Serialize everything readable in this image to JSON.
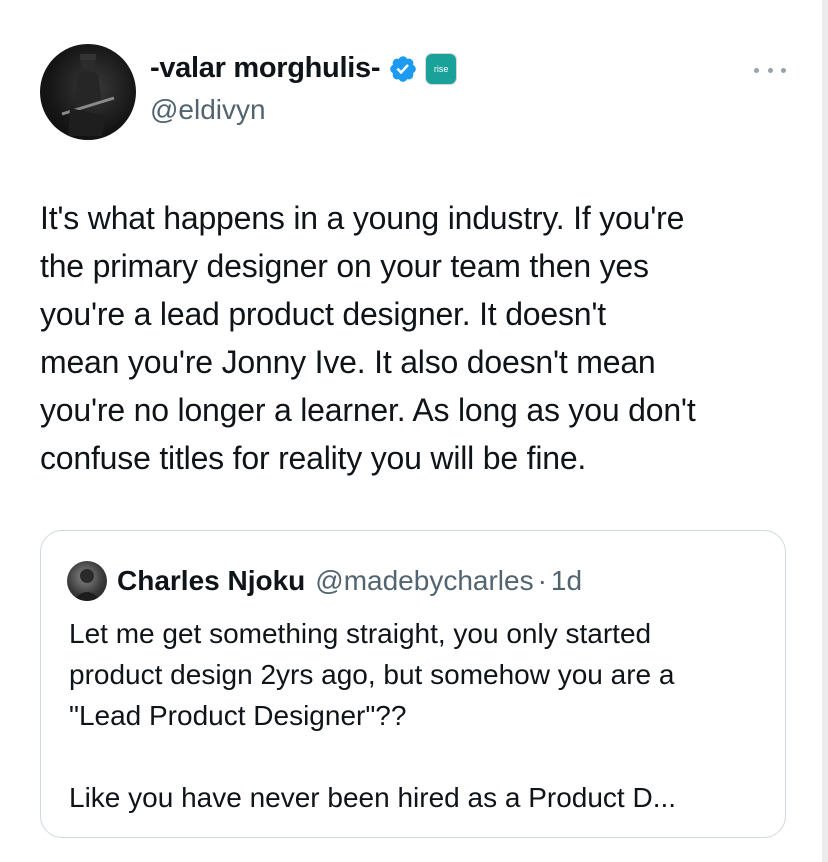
{
  "tweet": {
    "author": {
      "display_name": "-valar morghulis-",
      "handle": "@eldivyn",
      "verified": true,
      "affiliate_badge_text": "rise",
      "verified_color": "#1d9bf0",
      "affiliate_color": "#1aa29a",
      "avatar_icon": "avatar-photo"
    },
    "more_icon": "more-horizontal-icon",
    "text_lines": [
      "It's what happens in a young industry. If you're",
      "the primary designer on your team then yes",
      "you're a lead product designer. It doesn't",
      "mean you're Jonny Ive. It also doesn't mean",
      "you're no longer a learner. As long as you don't",
      "confuse titles for reality you will be fine."
    ]
  },
  "quoted_tweet": {
    "author": {
      "display_name": "Charles Njoku",
      "handle": "@madebycharles",
      "separator": "·",
      "time": "1d"
    },
    "paragraph_1_lines": [
      "Let me get something straight, you only started",
      "product design 2yrs ago, but somehow you are a",
      "\"Lead Product Designer\"??"
    ],
    "paragraph_2_lines": [
      "Like you have never been hired as a Product D..."
    ]
  }
}
